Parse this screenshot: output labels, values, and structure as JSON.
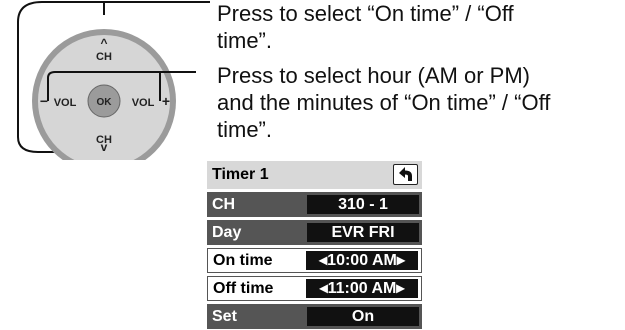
{
  "remote": {
    "ch_up": "CH",
    "ch_down": "CH",
    "vol_minus": "VOL",
    "vol_plus": "VOL",
    "ok": "OK"
  },
  "captions": {
    "ch_line1": "Press to select “On time” / “Off",
    "ch_line2": "time”.",
    "vol_line1": "Press to select hour (AM or PM)",
    "vol_line2": "and the minutes of “On time” / “Off",
    "vol_line3": "time”."
  },
  "menu": {
    "title": "Timer 1",
    "back_icon": "return-arrow-icon",
    "rows": [
      {
        "label": "CH",
        "value": "310 - 1"
      },
      {
        "label": "Day",
        "value": "EVR FRI"
      },
      {
        "label": "On time",
        "value": "10:00 AM"
      },
      {
        "label": "Off time",
        "value": "11:00 AM"
      },
      {
        "label": "Set",
        "value": "On"
      }
    ]
  }
}
